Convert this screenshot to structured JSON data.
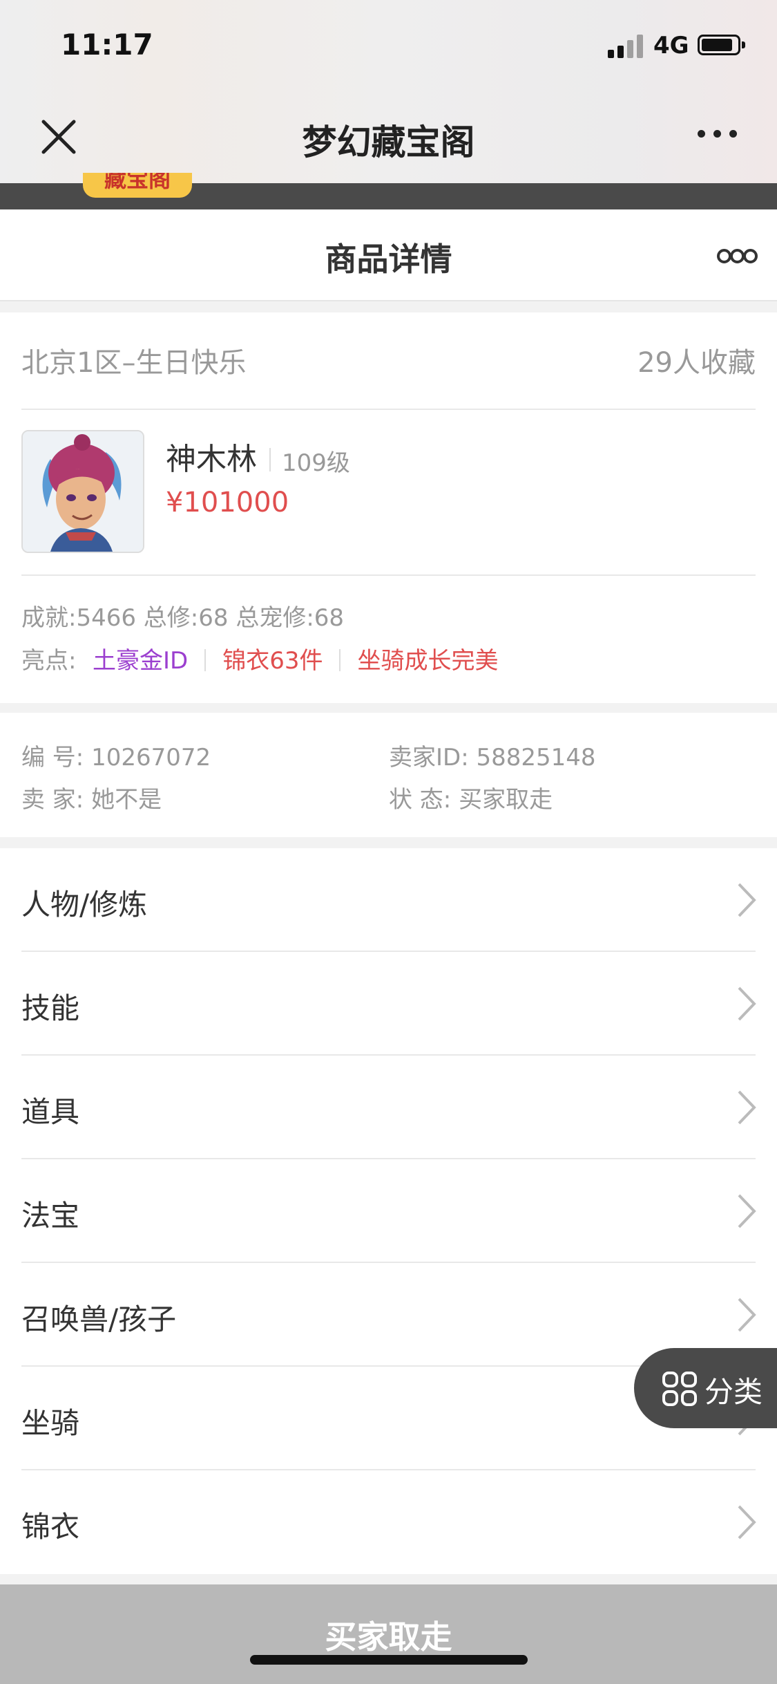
{
  "status_bar": {
    "time": "11:17",
    "network": "4G"
  },
  "wx_header": {
    "title": "梦幻藏宝阁",
    "logo_text": "藏宝阁"
  },
  "page": {
    "title": "商品详情"
  },
  "product": {
    "server": "北京1区–生日快乐",
    "favorites": "29人收藏",
    "character_name": "神木林",
    "level": "109级",
    "price": "¥101000",
    "stats": "成就:5466 总修:68 总宠修:68",
    "highlights_label": "亮点:",
    "highlights": [
      {
        "text": "土豪金ID",
        "color": "#9b3fcf"
      },
      {
        "text": "锦衣63件",
        "color": "#e04e4e"
      },
      {
        "text": "坐骑成长完美",
        "color": "#e04e4e"
      }
    ]
  },
  "info": {
    "serial": "编 号: 10267072",
    "seller_id": "卖家ID: 58825148",
    "seller": "卖 家: 她不是",
    "status": "状 态: 买家取走"
  },
  "nav": {
    "items": [
      {
        "label": "人物/修炼"
      },
      {
        "label": "技能"
      },
      {
        "label": "道具"
      },
      {
        "label": "法宝"
      },
      {
        "label": "召唤兽/孩子"
      },
      {
        "label": "坐骑"
      },
      {
        "label": "锦衣"
      }
    ]
  },
  "float_button": {
    "label": "分类",
    "icon": "grid-icon"
  },
  "bottom_bar": {
    "action_label": "买家取走"
  },
  "colors": {
    "price": "#e04e4e",
    "accent_purple": "#9b3fcf",
    "bottom_bar": "#b8b8b8",
    "float_button": "#4a4a4a"
  }
}
